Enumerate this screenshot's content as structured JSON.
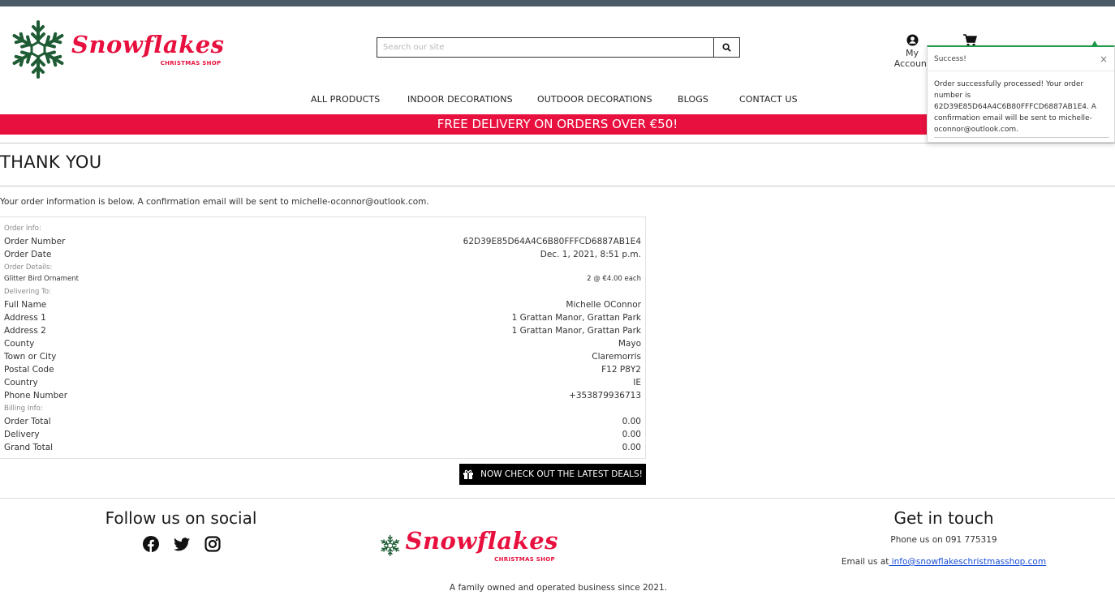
{
  "header": {
    "logo_title": "Snowflakes",
    "logo_subtitle": "CHRISTMAS SHOP",
    "search_placeholder": "Search our site",
    "account_label": "My Account"
  },
  "nav": {
    "items": [
      {
        "label": "ALL PRODUCTS"
      },
      {
        "label": "INDOOR DECORATIONS"
      },
      {
        "label": "OUTDOOR DECORATIONS"
      },
      {
        "label": "BLOGS"
      },
      {
        "label": "CONTACT US"
      }
    ]
  },
  "banner": {
    "text": "FREE DELIVERY ON ORDERS OVER €50!"
  },
  "main": {
    "title": "THANK YOU",
    "intro": "Your order information is below. A confirmation email will be sent to michelle-oconnor@outlook.com."
  },
  "order": {
    "section_order_info": "Order Info:",
    "order_number_label": "Order Number",
    "order_number": "62D39E85D64A4C6B80FFFCD6887AB1E4",
    "order_date_label": "Order Date",
    "order_date": "Dec. 1, 2021, 8:51 p.m.",
    "section_order_details": "Order Details:",
    "item_name": "Glitter Bird Ornament",
    "item_qty": "2 @ €4.00 each",
    "section_delivering": "Delivering To:",
    "full_name_label": "Full Name",
    "full_name": "Michelle OConnor",
    "address1_label": "Address 1",
    "address1": "1 Grattan Manor, Grattan Park",
    "address2_label": "Address 2",
    "address2": "1 Grattan Manor, Grattan Park",
    "county_label": "County",
    "county": "Mayo",
    "town_label": "Town or City",
    "town": "Claremorris",
    "postcode_label": "Postal Code",
    "postcode": "F12 P8Y2",
    "country_label": "Country",
    "country": "IE",
    "phone_label": "Phone Number",
    "phone": "+353879936713",
    "section_billing": "Billing Info:",
    "order_total_label": "Order Total",
    "order_total": "0.00",
    "delivery_label": "Delivery",
    "delivery": "0.00",
    "grand_total_label": "Grand Total",
    "grand_total": "0.00"
  },
  "deals_button": "NOW CHECK OUT THE LATEST DEALS!",
  "footer": {
    "follow_title": "Follow us on social",
    "logo_title": "Snowflakes",
    "logo_subtitle": "CHRISTMAS SHOP",
    "tagline": "A family owned and operated business since 2021.",
    "touch_title": "Get in touch",
    "phone_text": "Phone us on 091 775319",
    "email_prefix": "Email us at",
    "email_link": " info@snowflakeschristmasshop.com"
  },
  "toast": {
    "title": "Success!",
    "close": "×",
    "message": "Order successfully processed! Your order number is 62D39E85D64A4C6B80FFFCD6887AB1E4. A confirmation email will be sent to michelle-oconnor@outlook.com."
  },
  "colors": {
    "brand_red": "#e8103e",
    "snowflake_green": "#1f5c35",
    "topbar": "#4a5a66",
    "toast_accent": "#1f9a4b"
  },
  "icons": [
    "snowflake-logo-icon",
    "search-icon",
    "account-icon",
    "cart-icon",
    "gift-icon",
    "facebook-icon",
    "twitter-icon",
    "instagram-icon"
  ]
}
